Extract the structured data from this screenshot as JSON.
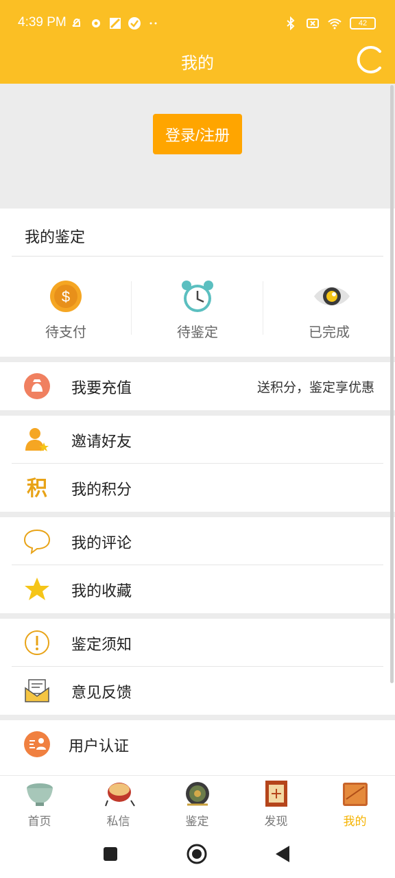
{
  "status_bar": {
    "time": "4:39 PM",
    "battery": "42",
    "icons": [
      "mute-icon",
      "settings-icon",
      "app-icon",
      "check-circle-icon",
      "more-dots-icon",
      "bluetooth-icon",
      "sim-off-icon",
      "wifi-icon",
      "battery-icon"
    ]
  },
  "header": {
    "title": "我的",
    "refresh_icon": "refresh-icon"
  },
  "login": {
    "button_label": "登录/注册"
  },
  "appraisal": {
    "title": "我的鉴定",
    "statuses": [
      {
        "label": "待支付",
        "icon": "coin-icon"
      },
      {
        "label": "待鉴定",
        "icon": "alarm-clock-icon"
      },
      {
        "label": "已完成",
        "icon": "eye-icon"
      }
    ]
  },
  "recharge": {
    "label": "我要充值",
    "promo": "送积分，鉴定享优惠",
    "icon": "money-bag-icon"
  },
  "menu": {
    "invite": "邀请好友",
    "points": "我的积分",
    "comments": "我的评论",
    "favorites": "我的收藏",
    "notice": "鉴定须知",
    "feedback": "意见反馈",
    "verify": "用户认证",
    "points_icon_glyph": "积"
  },
  "bottom_nav": {
    "items": [
      {
        "label": "首页",
        "icon": "bowl-icon"
      },
      {
        "label": "私信",
        "icon": "drum-icon"
      },
      {
        "label": "鉴定",
        "icon": "bronze-mirror-icon"
      },
      {
        "label": "发现",
        "icon": "screen-frame-icon"
      },
      {
        "label": "我的",
        "icon": "wood-box-icon"
      }
    ],
    "active_color": "#f5b301"
  },
  "colors": {
    "brand": "#fbbf24",
    "button": "#ffa500",
    "background_gray": "#ececec"
  }
}
